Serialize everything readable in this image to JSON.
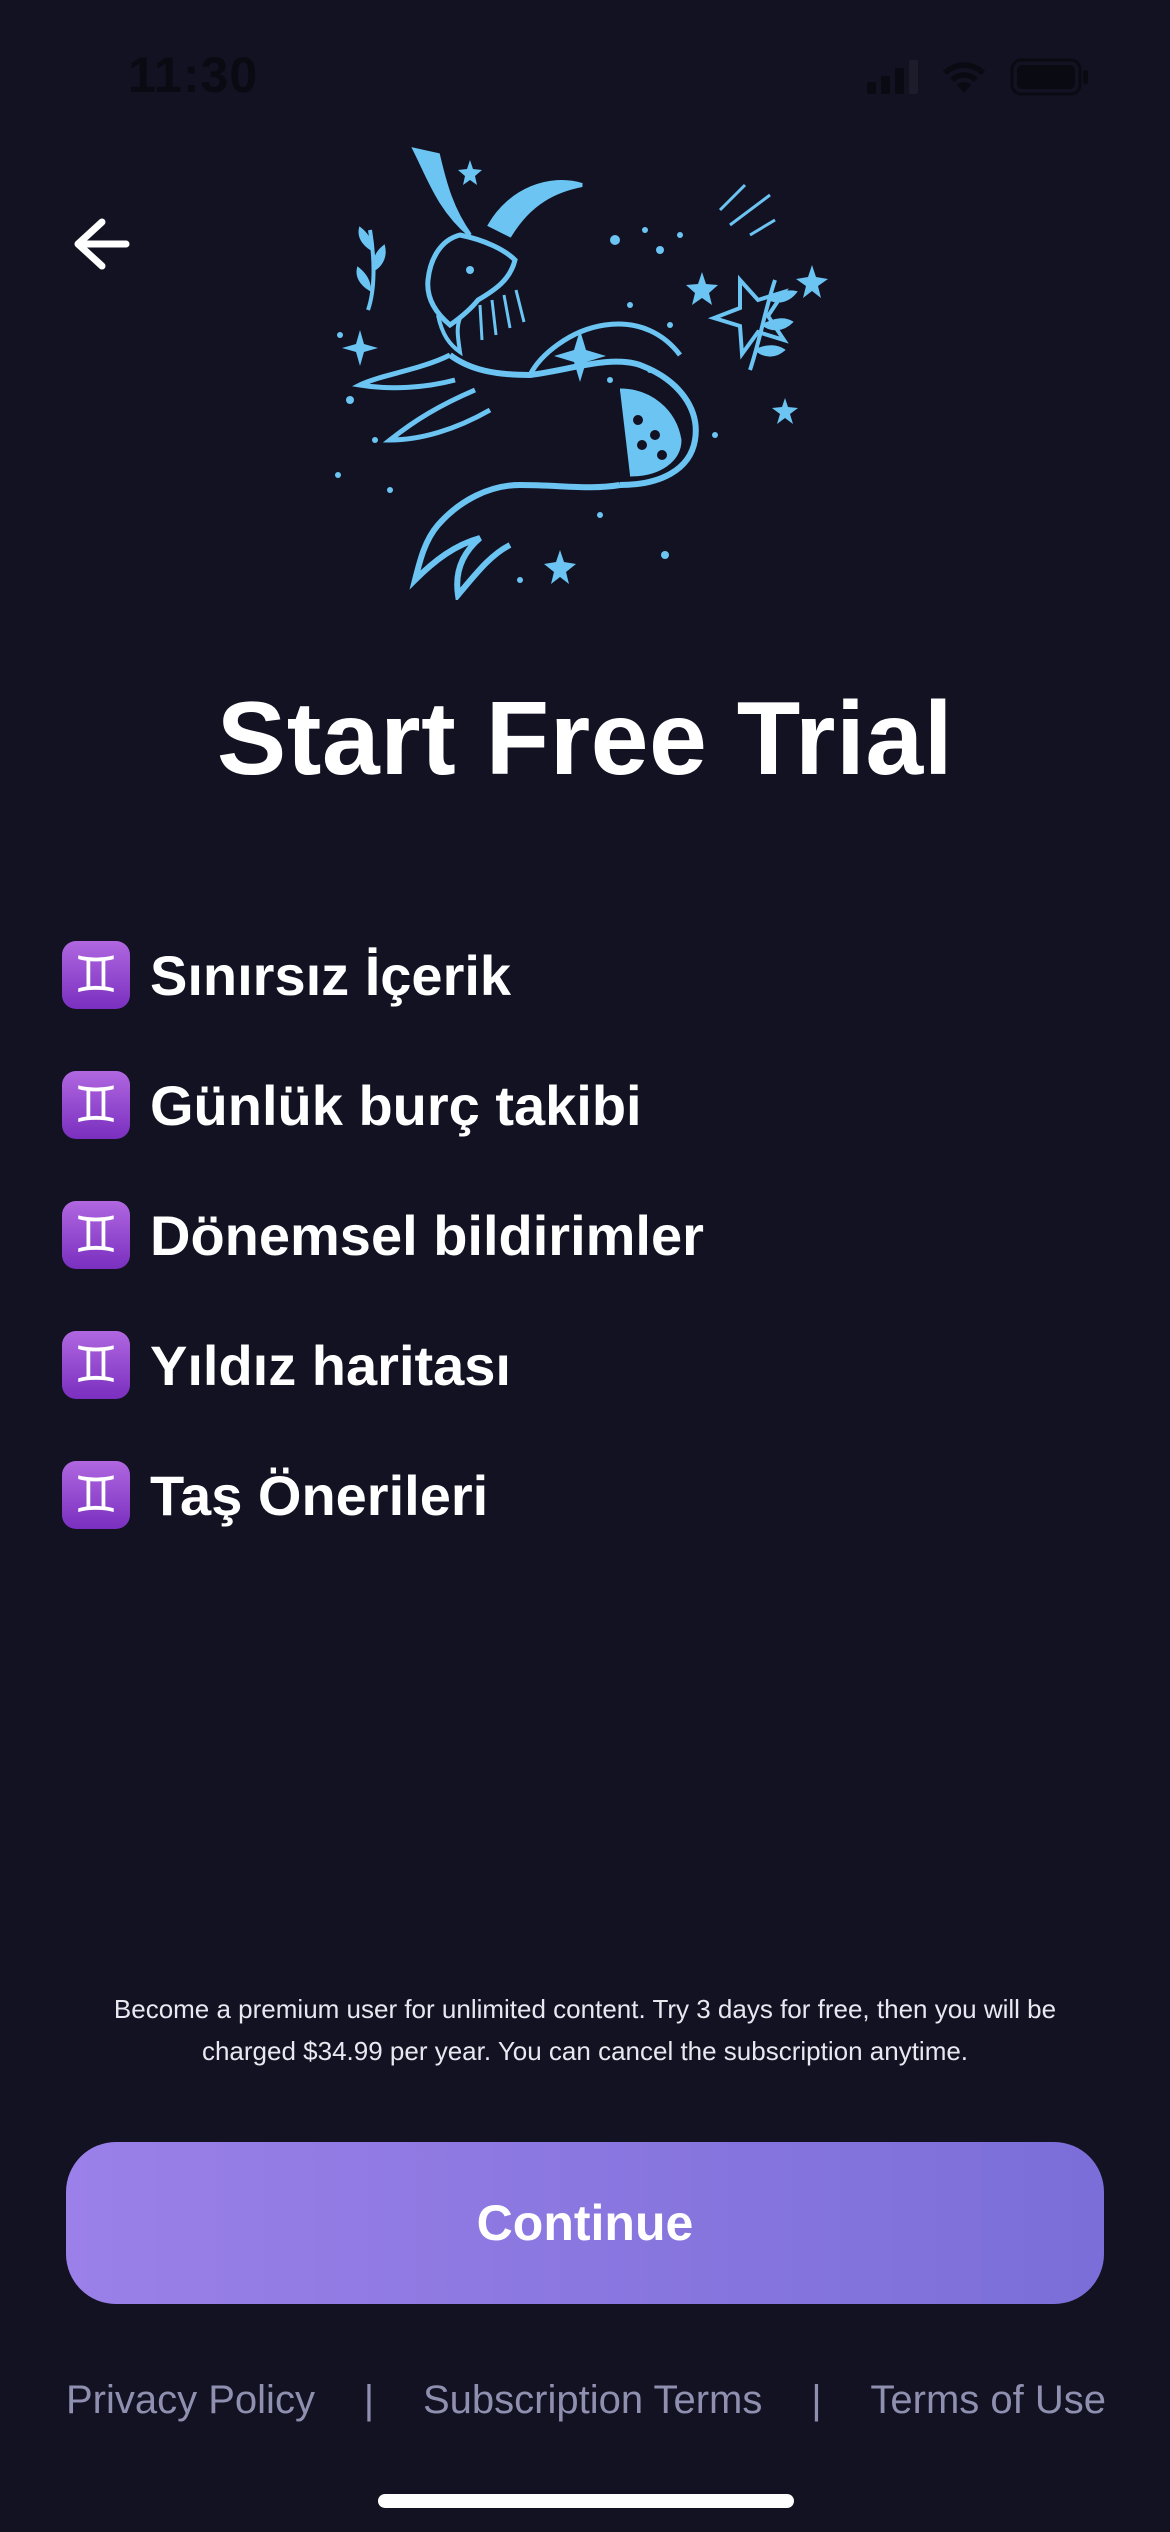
{
  "status_bar": {
    "time": "11:30"
  },
  "title": "Start Free Trial",
  "features": [
    {
      "icon": "♊",
      "label": "Sınırsız İçerik"
    },
    {
      "icon": "♊",
      "label": "Günlük burç takibi"
    },
    {
      "icon": "♊",
      "label": "Dönemsel bildirimler"
    },
    {
      "icon": "♊",
      "label": "Yıldız haritası"
    },
    {
      "icon": "♊",
      "label": "Taş Önerileri"
    }
  ],
  "disclaimer": {
    "line1": "Become a premium user for unlimited content. Try 3 days for free, then you will be",
    "line2": "charged $34.99 per year. You can cancel the subscription anytime."
  },
  "continue_label": "Continue",
  "footer": {
    "privacy": "Privacy Policy",
    "subscription": "Subscription Terms",
    "terms": "Terms of Use",
    "separator": "|"
  },
  "colors": {
    "background": "#121223",
    "accent": "#8a78e0",
    "illustration": "#6cc4f2",
    "link": "#8f8fb0"
  },
  "icons": {
    "back": "arrow-left-icon",
    "illustration": "capricorn-zodiac-illustration",
    "feature": "gemini-sign-icon"
  }
}
